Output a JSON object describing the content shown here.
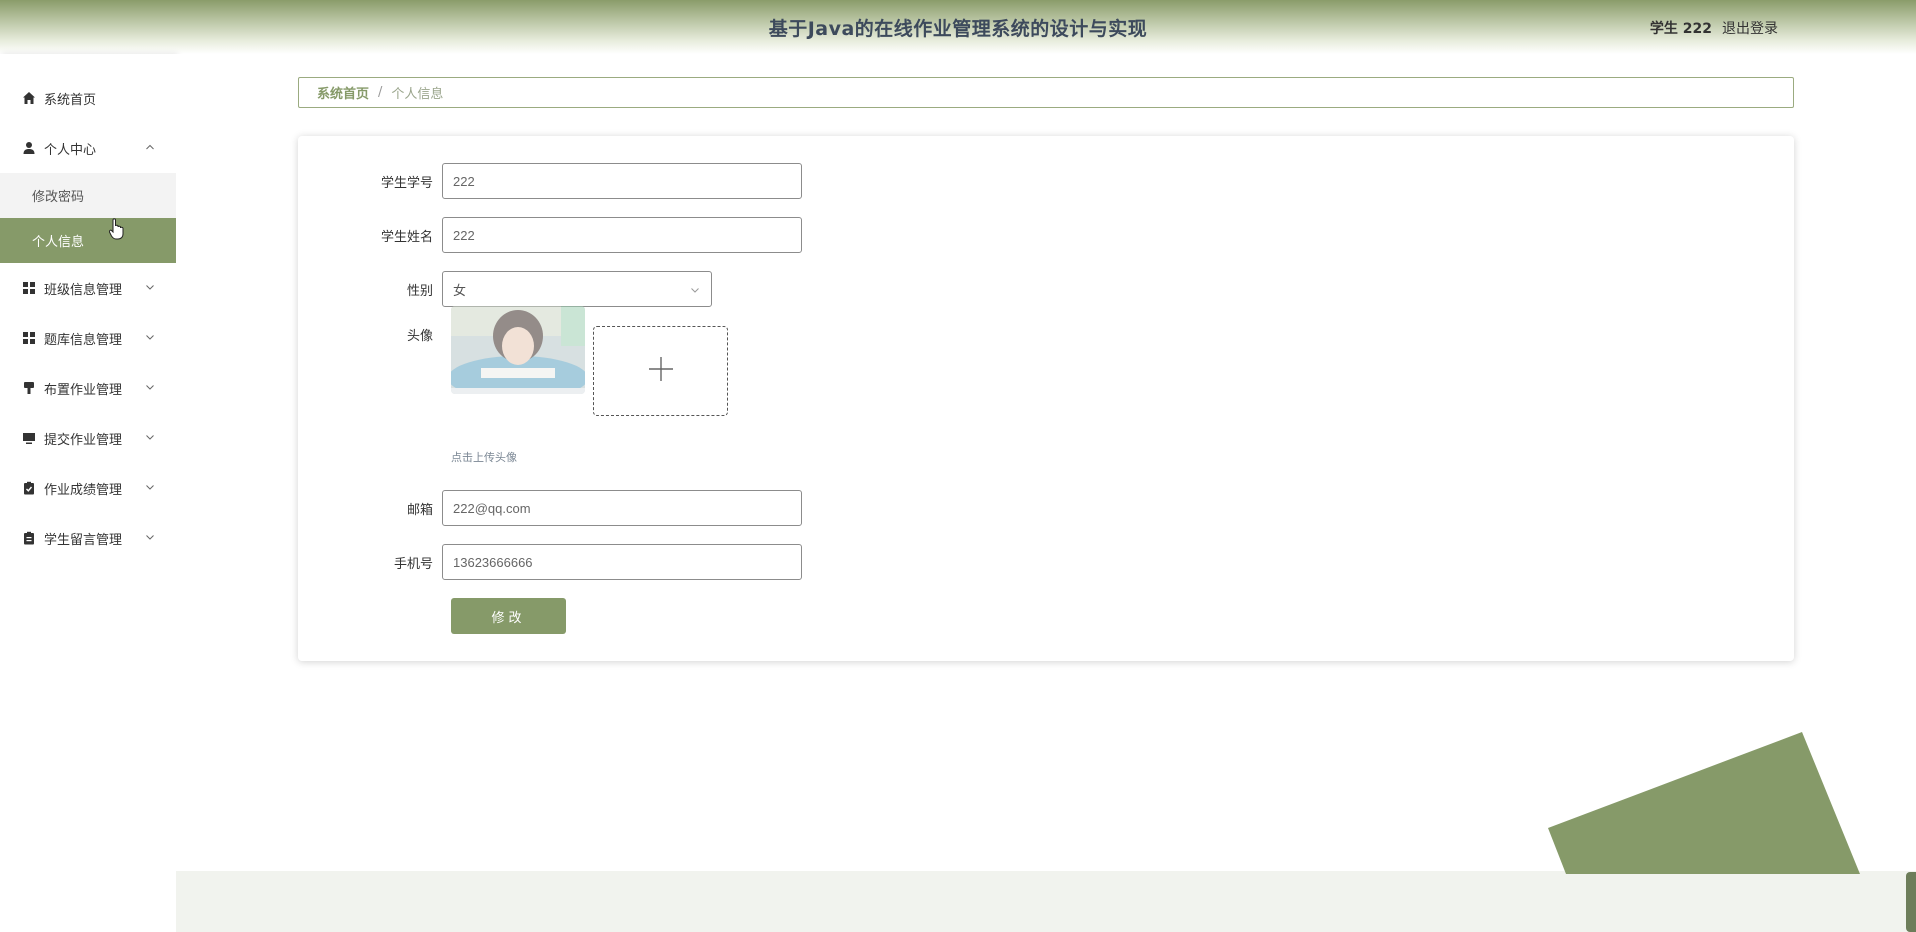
{
  "header": {
    "title": "基于Java的在线作业管理系统的设计与实现",
    "user_label": "学生 222",
    "logout_label": "退出登录"
  },
  "sidebar": {
    "items": [
      {
        "label": "系统首页",
        "icon": "home-icon"
      },
      {
        "label": "个人中心",
        "icon": "user-icon",
        "expanded": true,
        "children": [
          {
            "label": "修改密码"
          },
          {
            "label": "个人信息",
            "active": true
          }
        ]
      },
      {
        "label": "班级信息管理",
        "icon": "grid-icon"
      },
      {
        "label": "题库信息管理",
        "icon": "grid-icon"
      },
      {
        "label": "布置作业管理",
        "icon": "brush-icon"
      },
      {
        "label": "提交作业管理",
        "icon": "monitor-icon"
      },
      {
        "label": "作业成绩管理",
        "icon": "clipboard-check-icon"
      },
      {
        "label": "学生留言管理",
        "icon": "clipboard-icon"
      }
    ]
  },
  "breadcrumb": {
    "home": "系统首页",
    "separator": "/",
    "current": "个人信息"
  },
  "form": {
    "student_id": {
      "label": "学生学号",
      "value": "222"
    },
    "student_name": {
      "label": "学生姓名",
      "value": "222"
    },
    "gender": {
      "label": "性别",
      "value": "女"
    },
    "avatar": {
      "label": "头像",
      "hint": "点击上传头像"
    },
    "email": {
      "label": "邮箱",
      "value": "222@qq.com"
    },
    "phone": {
      "label": "手机号",
      "value": "13623666666"
    },
    "submit_label": "修改"
  },
  "colors": {
    "accent": "#869a69",
    "header_dark": "#8a9c6a",
    "title_text": "#3d4a5c"
  }
}
